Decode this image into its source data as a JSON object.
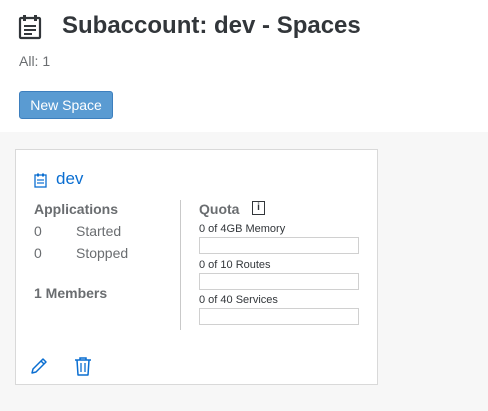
{
  "header": {
    "title": "Subaccount: dev - Spaces",
    "count": "All: 1",
    "new_space_label": "New Space",
    "icon": "spaces-list-icon"
  },
  "space": {
    "name": "dev",
    "icon": "space-document-icon",
    "applications": {
      "heading": "Applications",
      "started": {
        "count": "0",
        "label": "Started"
      },
      "stopped": {
        "count": "0",
        "label": "Stopped"
      }
    },
    "members": "1 Members",
    "quota": {
      "heading": "Quota",
      "info_icon_text": "i",
      "items": [
        {
          "label": "0 of 4GB Memory",
          "used_fraction": 0
        },
        {
          "label": "0 of 10 Routes",
          "used_fraction": 0
        },
        {
          "label": "0 of 40 Services",
          "used_fraction": 0
        }
      ]
    },
    "actions": {
      "edit_icon": "edit-pencil-icon",
      "delete_icon": "trash-icon"
    }
  },
  "colors": {
    "accent": "#0a6ed1",
    "button": "#5a9bd2",
    "text": "#32363a",
    "muted": "#6a6d70"
  }
}
